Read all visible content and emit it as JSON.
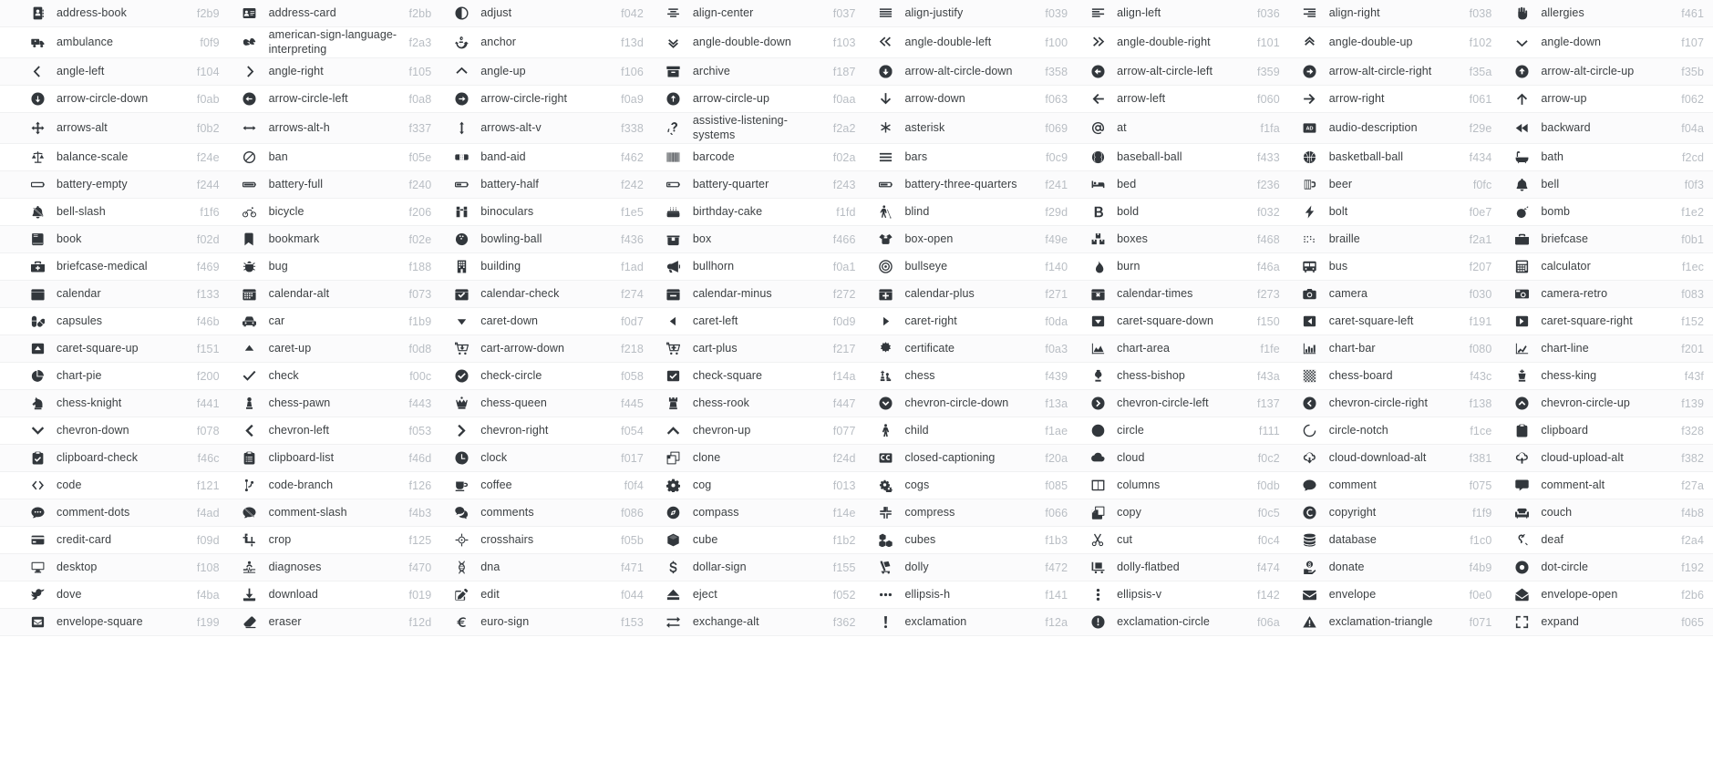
{
  "page": {
    "title": "Font Awesome icon cheatsheet",
    "columns": 6,
    "text_color": "#3c4043",
    "code_color": "#b9bec4",
    "icon_color": "#32373c",
    "row_stripe_color": "#fbfbfc",
    "row_base_color": "#ffffff"
  },
  "rows": [
    [
      {
        "name": "address-book",
        "code": "f2b9",
        "icon": "address-book-icon"
      },
      {
        "name": "address-card",
        "code": "f2bb",
        "icon": "address-card-icon"
      },
      {
        "name": "adjust",
        "code": "f042",
        "icon": "adjust-icon"
      },
      {
        "name": "align-center",
        "code": "f037",
        "icon": "align-center-icon"
      },
      {
        "name": "align-justify",
        "code": "f039",
        "icon": "align-justify-icon"
      },
      {
        "name": "align-left",
        "code": "f036",
        "icon": "align-left-icon"
      },
      {
        "name": "align-right",
        "code": "f038",
        "icon": "align-right-icon"
      },
      {
        "name": "allergies",
        "code": "f461",
        "icon": "allergies-icon"
      }
    ],
    [
      {
        "name": "ambulance",
        "code": "f0f9",
        "icon": "ambulance-icon"
      },
      {
        "name": "american-sign-language-interpreting",
        "code": "f2a3",
        "icon": "american-sign-language-interpreting-icon"
      },
      {
        "name": "anchor",
        "code": "f13d",
        "icon": "anchor-icon"
      },
      {
        "name": "angle-double-down",
        "code": "f103",
        "icon": "angle-double-down-icon"
      },
      {
        "name": "angle-double-left",
        "code": "f100",
        "icon": "angle-double-left-icon"
      },
      {
        "name": "angle-double-right",
        "code": "f101",
        "icon": "angle-double-right-icon"
      },
      {
        "name": "angle-double-up",
        "code": "f102",
        "icon": "angle-double-up-icon"
      },
      {
        "name": "angle-down",
        "code": "f107",
        "icon": "angle-down-icon"
      }
    ],
    [
      {
        "name": "angle-left",
        "code": "f104",
        "icon": "angle-left-icon"
      },
      {
        "name": "angle-right",
        "code": "f105",
        "icon": "angle-right-icon"
      },
      {
        "name": "angle-up",
        "code": "f106",
        "icon": "angle-up-icon"
      },
      {
        "name": "archive",
        "code": "f187",
        "icon": "archive-icon"
      },
      {
        "name": "arrow-alt-circle-down",
        "code": "f358",
        "icon": "arrow-alt-circle-down-icon"
      },
      {
        "name": "arrow-alt-circle-left",
        "code": "f359",
        "icon": "arrow-alt-circle-left-icon"
      },
      {
        "name": "arrow-alt-circle-right",
        "code": "f35a",
        "icon": "arrow-alt-circle-right-icon"
      },
      {
        "name": "arrow-alt-circle-up",
        "code": "f35b",
        "icon": "arrow-alt-circle-up-icon"
      }
    ],
    [
      {
        "name": "arrow-circle-down",
        "code": "f0ab",
        "icon": "arrow-circle-down-icon"
      },
      {
        "name": "arrow-circle-left",
        "code": "f0a8",
        "icon": "arrow-circle-left-icon"
      },
      {
        "name": "arrow-circle-right",
        "code": "f0a9",
        "icon": "arrow-circle-right-icon"
      },
      {
        "name": "arrow-circle-up",
        "code": "f0aa",
        "icon": "arrow-circle-up-icon"
      },
      {
        "name": "arrow-down",
        "code": "f063",
        "icon": "arrow-down-icon"
      },
      {
        "name": "arrow-left",
        "code": "f060",
        "icon": "arrow-left-icon"
      },
      {
        "name": "arrow-right",
        "code": "f061",
        "icon": "arrow-right-icon"
      },
      {
        "name": "arrow-up",
        "code": "f062",
        "icon": "arrow-up-icon"
      }
    ],
    [
      {
        "name": "arrows-alt",
        "code": "f0b2",
        "icon": "arrows-alt-icon"
      },
      {
        "name": "arrows-alt-h",
        "code": "f337",
        "icon": "arrows-alt-h-icon"
      },
      {
        "name": "arrows-alt-v",
        "code": "f338",
        "icon": "arrows-alt-v-icon"
      },
      {
        "name": "assistive-listening-systems",
        "code": "f2a2",
        "icon": "assistive-listening-systems-icon"
      },
      {
        "name": "asterisk",
        "code": "f069",
        "icon": "asterisk-icon"
      },
      {
        "name": "at",
        "code": "f1fa",
        "icon": "at-icon"
      },
      {
        "name": "audio-description",
        "code": "f29e",
        "icon": "audio-description-icon"
      },
      {
        "name": "backward",
        "code": "f04a",
        "icon": "backward-icon"
      }
    ],
    [
      {
        "name": "balance-scale",
        "code": "f24e",
        "icon": "balance-scale-icon"
      },
      {
        "name": "ban",
        "code": "f05e",
        "icon": "ban-icon"
      },
      {
        "name": "band-aid",
        "code": "f462",
        "icon": "band-aid-icon"
      },
      {
        "name": "barcode",
        "code": "f02a",
        "icon": "barcode-icon"
      },
      {
        "name": "bars",
        "code": "f0c9",
        "icon": "bars-icon"
      },
      {
        "name": "baseball-ball",
        "code": "f433",
        "icon": "baseball-ball-icon"
      },
      {
        "name": "basketball-ball",
        "code": "f434",
        "icon": "basketball-ball-icon"
      },
      {
        "name": "bath",
        "code": "f2cd",
        "icon": "bath-icon"
      }
    ],
    [
      {
        "name": "battery-empty",
        "code": "f244",
        "icon": "battery-empty-icon"
      },
      {
        "name": "battery-full",
        "code": "f240",
        "icon": "battery-full-icon"
      },
      {
        "name": "battery-half",
        "code": "f242",
        "icon": "battery-half-icon"
      },
      {
        "name": "battery-quarter",
        "code": "f243",
        "icon": "battery-quarter-icon"
      },
      {
        "name": "battery-three-quarters",
        "code": "f241",
        "icon": "battery-three-quarters-icon"
      },
      {
        "name": "bed",
        "code": "f236",
        "icon": "bed-icon"
      },
      {
        "name": "beer",
        "code": "f0fc",
        "icon": "beer-icon"
      },
      {
        "name": "bell",
        "code": "f0f3",
        "icon": "bell-icon"
      }
    ],
    [
      {
        "name": "bell-slash",
        "code": "f1f6",
        "icon": "bell-slash-icon"
      },
      {
        "name": "bicycle",
        "code": "f206",
        "icon": "bicycle-icon"
      },
      {
        "name": "binoculars",
        "code": "f1e5",
        "icon": "binoculars-icon"
      },
      {
        "name": "birthday-cake",
        "code": "f1fd",
        "icon": "birthday-cake-icon"
      },
      {
        "name": "blind",
        "code": "f29d",
        "icon": "blind-icon"
      },
      {
        "name": "bold",
        "code": "f032",
        "icon": "bold-icon"
      },
      {
        "name": "bolt",
        "code": "f0e7",
        "icon": "bolt-icon"
      },
      {
        "name": "bomb",
        "code": "f1e2",
        "icon": "bomb-icon"
      }
    ],
    [
      {
        "name": "book",
        "code": "f02d",
        "icon": "book-icon"
      },
      {
        "name": "bookmark",
        "code": "f02e",
        "icon": "bookmark-icon"
      },
      {
        "name": "bowling-ball",
        "code": "f436",
        "icon": "bowling-ball-icon"
      },
      {
        "name": "box",
        "code": "f466",
        "icon": "box-icon"
      },
      {
        "name": "box-open",
        "code": "f49e",
        "icon": "box-open-icon"
      },
      {
        "name": "boxes",
        "code": "f468",
        "icon": "boxes-icon"
      },
      {
        "name": "braille",
        "code": "f2a1",
        "icon": "braille-icon"
      },
      {
        "name": "briefcase",
        "code": "f0b1",
        "icon": "briefcase-icon"
      }
    ],
    [
      {
        "name": "briefcase-medical",
        "code": "f469",
        "icon": "briefcase-medical-icon"
      },
      {
        "name": "bug",
        "code": "f188",
        "icon": "bug-icon"
      },
      {
        "name": "building",
        "code": "f1ad",
        "icon": "building-icon"
      },
      {
        "name": "bullhorn",
        "code": "f0a1",
        "icon": "bullhorn-icon"
      },
      {
        "name": "bullseye",
        "code": "f140",
        "icon": "bullseye-icon"
      },
      {
        "name": "burn",
        "code": "f46a",
        "icon": "burn-icon"
      },
      {
        "name": "bus",
        "code": "f207",
        "icon": "bus-icon"
      },
      {
        "name": "calculator",
        "code": "f1ec",
        "icon": "calculator-icon"
      }
    ],
    [
      {
        "name": "calendar",
        "code": "f133",
        "icon": "calendar-icon"
      },
      {
        "name": "calendar-alt",
        "code": "f073",
        "icon": "calendar-alt-icon"
      },
      {
        "name": "calendar-check",
        "code": "f274",
        "icon": "calendar-check-icon"
      },
      {
        "name": "calendar-minus",
        "code": "f272",
        "icon": "calendar-minus-icon"
      },
      {
        "name": "calendar-plus",
        "code": "f271",
        "icon": "calendar-plus-icon"
      },
      {
        "name": "calendar-times",
        "code": "f273",
        "icon": "calendar-times-icon"
      },
      {
        "name": "camera",
        "code": "f030",
        "icon": "camera-icon"
      },
      {
        "name": "camera-retro",
        "code": "f083",
        "icon": "camera-retro-icon"
      }
    ],
    [
      {
        "name": "capsules",
        "code": "f46b",
        "icon": "capsules-icon"
      },
      {
        "name": "car",
        "code": "f1b9",
        "icon": "car-icon"
      },
      {
        "name": "caret-down",
        "code": "f0d7",
        "icon": "caret-down-icon"
      },
      {
        "name": "caret-left",
        "code": "f0d9",
        "icon": "caret-left-icon"
      },
      {
        "name": "caret-right",
        "code": "f0da",
        "icon": "caret-right-icon"
      },
      {
        "name": "caret-square-down",
        "code": "f150",
        "icon": "caret-square-down-icon"
      },
      {
        "name": "caret-square-left",
        "code": "f191",
        "icon": "caret-square-left-icon"
      },
      {
        "name": "caret-square-right",
        "code": "f152",
        "icon": "caret-square-right-icon"
      }
    ],
    [
      {
        "name": "caret-square-up",
        "code": "f151",
        "icon": "caret-square-up-icon"
      },
      {
        "name": "caret-up",
        "code": "f0d8",
        "icon": "caret-up-icon"
      },
      {
        "name": "cart-arrow-down",
        "code": "f218",
        "icon": "cart-arrow-down-icon"
      },
      {
        "name": "cart-plus",
        "code": "f217",
        "icon": "cart-plus-icon"
      },
      {
        "name": "certificate",
        "code": "f0a3",
        "icon": "certificate-icon"
      },
      {
        "name": "chart-area",
        "code": "f1fe",
        "icon": "chart-area-icon"
      },
      {
        "name": "chart-bar",
        "code": "f080",
        "icon": "chart-bar-icon"
      },
      {
        "name": "chart-line",
        "code": "f201",
        "icon": "chart-line-icon"
      }
    ],
    [
      {
        "name": "chart-pie",
        "code": "f200",
        "icon": "chart-pie-icon"
      },
      {
        "name": "check",
        "code": "f00c",
        "icon": "check-icon"
      },
      {
        "name": "check-circle",
        "code": "f058",
        "icon": "check-circle-icon"
      },
      {
        "name": "check-square",
        "code": "f14a",
        "icon": "check-square-icon"
      },
      {
        "name": "chess",
        "code": "f439",
        "icon": "chess-icon"
      },
      {
        "name": "chess-bishop",
        "code": "f43a",
        "icon": "chess-bishop-icon"
      },
      {
        "name": "chess-board",
        "code": "f43c",
        "icon": "chess-board-icon"
      },
      {
        "name": "chess-king",
        "code": "f43f",
        "icon": "chess-king-icon"
      }
    ],
    [
      {
        "name": "chess-knight",
        "code": "f441",
        "icon": "chess-knight-icon"
      },
      {
        "name": "chess-pawn",
        "code": "f443",
        "icon": "chess-pawn-icon"
      },
      {
        "name": "chess-queen",
        "code": "f445",
        "icon": "chess-queen-icon"
      },
      {
        "name": "chess-rook",
        "code": "f447",
        "icon": "chess-rook-icon"
      },
      {
        "name": "chevron-circle-down",
        "code": "f13a",
        "icon": "chevron-circle-down-icon"
      },
      {
        "name": "chevron-circle-left",
        "code": "f137",
        "icon": "chevron-circle-left-icon"
      },
      {
        "name": "chevron-circle-right",
        "code": "f138",
        "icon": "chevron-circle-right-icon"
      },
      {
        "name": "chevron-circle-up",
        "code": "f139",
        "icon": "chevron-circle-up-icon"
      }
    ],
    [
      {
        "name": "chevron-down",
        "code": "f078",
        "icon": "chevron-down-icon"
      },
      {
        "name": "chevron-left",
        "code": "f053",
        "icon": "chevron-left-icon"
      },
      {
        "name": "chevron-right",
        "code": "f054",
        "icon": "chevron-right-icon"
      },
      {
        "name": "chevron-up",
        "code": "f077",
        "icon": "chevron-up-icon"
      },
      {
        "name": "child",
        "code": "f1ae",
        "icon": "child-icon"
      },
      {
        "name": "circle",
        "code": "f111",
        "icon": "circle-icon"
      },
      {
        "name": "circle-notch",
        "code": "f1ce",
        "icon": "circle-notch-icon"
      },
      {
        "name": "clipboard",
        "code": "f328",
        "icon": "clipboard-icon"
      }
    ],
    [
      {
        "name": "clipboard-check",
        "code": "f46c",
        "icon": "clipboard-check-icon"
      },
      {
        "name": "clipboard-list",
        "code": "f46d",
        "icon": "clipboard-list-icon"
      },
      {
        "name": "clock",
        "code": "f017",
        "icon": "clock-icon"
      },
      {
        "name": "clone",
        "code": "f24d",
        "icon": "clone-icon"
      },
      {
        "name": "closed-captioning",
        "code": "f20a",
        "icon": "closed-captioning-icon"
      },
      {
        "name": "cloud",
        "code": "f0c2",
        "icon": "cloud-icon"
      },
      {
        "name": "cloud-download-alt",
        "code": "f381",
        "icon": "cloud-download-alt-icon"
      },
      {
        "name": "cloud-upload-alt",
        "code": "f382",
        "icon": "cloud-upload-alt-icon"
      }
    ],
    [
      {
        "name": "code",
        "code": "f121",
        "icon": "code-icon"
      },
      {
        "name": "code-branch",
        "code": "f126",
        "icon": "code-branch-icon"
      },
      {
        "name": "coffee",
        "code": "f0f4",
        "icon": "coffee-icon"
      },
      {
        "name": "cog",
        "code": "f013",
        "icon": "cog-icon"
      },
      {
        "name": "cogs",
        "code": "f085",
        "icon": "cogs-icon"
      },
      {
        "name": "columns",
        "code": "f0db",
        "icon": "columns-icon"
      },
      {
        "name": "comment",
        "code": "f075",
        "icon": "comment-icon"
      },
      {
        "name": "comment-alt",
        "code": "f27a",
        "icon": "comment-alt-icon"
      }
    ],
    [
      {
        "name": "comment-dots",
        "code": "f4ad",
        "icon": "comment-dots-icon"
      },
      {
        "name": "comment-slash",
        "code": "f4b3",
        "icon": "comment-slash-icon"
      },
      {
        "name": "comments",
        "code": "f086",
        "icon": "comments-icon"
      },
      {
        "name": "compass",
        "code": "f14e",
        "icon": "compass-icon"
      },
      {
        "name": "compress",
        "code": "f066",
        "icon": "compress-icon"
      },
      {
        "name": "copy",
        "code": "f0c5",
        "icon": "copy-icon"
      },
      {
        "name": "copyright",
        "code": "f1f9",
        "icon": "copyright-icon"
      },
      {
        "name": "couch",
        "code": "f4b8",
        "icon": "couch-icon"
      }
    ],
    [
      {
        "name": "credit-card",
        "code": "f09d",
        "icon": "credit-card-icon"
      },
      {
        "name": "crop",
        "code": "f125",
        "icon": "crop-icon"
      },
      {
        "name": "crosshairs",
        "code": "f05b",
        "icon": "crosshairs-icon"
      },
      {
        "name": "cube",
        "code": "f1b2",
        "icon": "cube-icon"
      },
      {
        "name": "cubes",
        "code": "f1b3",
        "icon": "cubes-icon"
      },
      {
        "name": "cut",
        "code": "f0c4",
        "icon": "cut-icon"
      },
      {
        "name": "database",
        "code": "f1c0",
        "icon": "database-icon"
      },
      {
        "name": "deaf",
        "code": "f2a4",
        "icon": "deaf-icon"
      }
    ],
    [
      {
        "name": "desktop",
        "code": "f108",
        "icon": "desktop-icon"
      },
      {
        "name": "diagnoses",
        "code": "f470",
        "icon": "diagnoses-icon"
      },
      {
        "name": "dna",
        "code": "f471",
        "icon": "dna-icon"
      },
      {
        "name": "dollar-sign",
        "code": "f155",
        "icon": "dollar-sign-icon"
      },
      {
        "name": "dolly",
        "code": "f472",
        "icon": "dolly-icon"
      },
      {
        "name": "dolly-flatbed",
        "code": "f474",
        "icon": "dolly-flatbed-icon"
      },
      {
        "name": "donate",
        "code": "f4b9",
        "icon": "donate-icon"
      },
      {
        "name": "dot-circle",
        "code": "f192",
        "icon": "dot-circle-icon"
      }
    ],
    [
      {
        "name": "dove",
        "code": "f4ba",
        "icon": "dove-icon"
      },
      {
        "name": "download",
        "code": "f019",
        "icon": "download-icon"
      },
      {
        "name": "edit",
        "code": "f044",
        "icon": "edit-icon"
      },
      {
        "name": "eject",
        "code": "f052",
        "icon": "eject-icon"
      },
      {
        "name": "ellipsis-h",
        "code": "f141",
        "icon": "ellipsis-h-icon"
      },
      {
        "name": "ellipsis-v",
        "code": "f142",
        "icon": "ellipsis-v-icon"
      },
      {
        "name": "envelope",
        "code": "f0e0",
        "icon": "envelope-icon"
      },
      {
        "name": "envelope-open",
        "code": "f2b6",
        "icon": "envelope-open-icon"
      }
    ],
    [
      {
        "name": "envelope-square",
        "code": "f199",
        "icon": "envelope-square-icon"
      },
      {
        "name": "eraser",
        "code": "f12d",
        "icon": "eraser-icon"
      },
      {
        "name": "euro-sign",
        "code": "f153",
        "icon": "euro-sign-icon"
      },
      {
        "name": "exchange-alt",
        "code": "f362",
        "icon": "exchange-alt-icon"
      },
      {
        "name": "exclamation",
        "code": "f12a",
        "icon": "exclamation-icon"
      },
      {
        "name": "exclamation-circle",
        "code": "f06a",
        "icon": "exclamation-circle-icon"
      },
      {
        "name": "exclamation-triangle",
        "code": "f071",
        "icon": "exclamation-triangle-icon"
      },
      {
        "name": "expand",
        "code": "f065",
        "icon": "expand-icon"
      }
    ]
  ]
}
